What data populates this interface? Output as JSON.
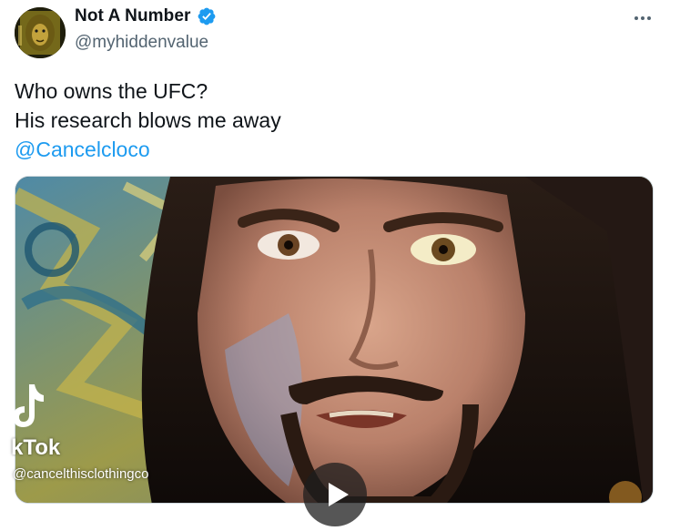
{
  "author": {
    "display_name": "Not A Number",
    "handle": "@myhiddenvalue",
    "verified_icon": "verified-badge-icon",
    "avatar_icon": "lion-avatar"
  },
  "menu": {
    "more_icon": "more-horizontal-icon"
  },
  "tweet": {
    "line1": "Who owns the UFC?",
    "line2": "His research blows me away",
    "mention": "@Cancelcloco"
  },
  "media": {
    "type": "video",
    "watermark_word": "kTok",
    "watermark_handle": "@cancelthisclothingco",
    "play_icon": "play-icon"
  },
  "colors": {
    "accent": "#1d9bf0",
    "text": "#0f1419",
    "secondary": "#536471"
  }
}
